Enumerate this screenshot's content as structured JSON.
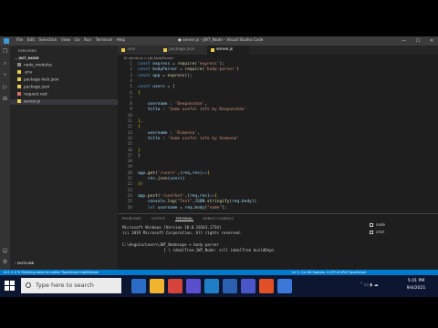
{
  "window": {
    "title": "● server.js - JWT_Node - Visual Studio Code",
    "menu": [
      "File",
      "Edit",
      "Selection",
      "View",
      "Go",
      "Run",
      "Terminal",
      "Help"
    ]
  },
  "explorer": {
    "title": "EXPLORER",
    "folder": "JWT_NODE",
    "files": [
      {
        "name": "node_modules",
        "color": "#8a8a8a"
      },
      {
        "name": ".env",
        "color": "#e8c94b"
      },
      {
        "name": "package-lock.json",
        "color": "#e8c94b"
      },
      {
        "name": "package.json",
        "color": "#e8c94b"
      },
      {
        "name": "request.rest",
        "color": "#d46a6a"
      },
      {
        "name": "server.js",
        "color": "#e8c94b"
      }
    ],
    "outline_label": "OUTLINE"
  },
  "tabs": [
    ".env",
    "package.json",
    "server.js"
  ],
  "breadcrumb": "JS server.js > [ø] bodyParser",
  "code": {
    "line_numbers": [
      "1",
      "2",
      "3",
      "4",
      "5",
      "6",
      "7",
      "8",
      "9",
      "10",
      "11",
      "12",
      "13",
      "14",
      "15",
      "16",
      "17",
      "18",
      "19",
      "20",
      "21",
      "22",
      "23",
      "24",
      "25",
      "26"
    ],
    "lines": [
      [
        {
          "c": "k",
          "t": "const "
        },
        {
          "c": "v",
          "t": "express"
        },
        {
          "c": "o",
          "t": " = "
        },
        {
          "c": "f",
          "t": "require"
        },
        {
          "c": "o",
          "t": "("
        },
        {
          "c": "s",
          "t": "'express'"
        },
        {
          "c": "o",
          "t": ");"
        }
      ],
      [
        {
          "c": "k",
          "t": "const "
        },
        {
          "c": "v",
          "t": "bodyParser"
        },
        {
          "c": "o",
          "t": " = "
        },
        {
          "c": "f",
          "t": "require"
        },
        {
          "c": "o",
          "t": "("
        },
        {
          "c": "s",
          "t": "'body-parser'"
        },
        {
          "c": "o",
          "t": ")"
        }
      ],
      [
        {
          "c": "k",
          "t": "const "
        },
        {
          "c": "v",
          "t": "app"
        },
        {
          "c": "o",
          "t": " = "
        },
        {
          "c": "f",
          "t": "express"
        },
        {
          "c": "o",
          "t": "();"
        }
      ],
      [],
      [
        {
          "c": "k",
          "t": "const "
        },
        {
          "c": "v",
          "t": "users"
        },
        {
          "c": "o",
          "t": " = ["
        }
      ],
      [
        {
          "c": "y",
          "t": "{"
        }
      ],
      [],
      [
        {
          "c": "o",
          "t": "    "
        },
        {
          "c": "v",
          "t": "username"
        },
        {
          "c": "o",
          "t": " : "
        },
        {
          "c": "s",
          "t": "'Deepanshan'"
        },
        {
          "c": "o",
          "t": ","
        }
      ],
      [
        {
          "c": "o",
          "t": "    "
        },
        {
          "c": "v",
          "t": "title"
        },
        {
          "c": "o",
          "t": " : "
        },
        {
          "c": "s",
          "t": "'Some useful info by Deepanshan'"
        }
      ],
      [],
      [
        {
          "c": "y",
          "t": "},"
        }
      ],
      [
        {
          "c": "y",
          "t": "{"
        }
      ],
      [
        {
          "c": "o",
          "t": "    "
        },
        {
          "c": "v",
          "t": "username"
        },
        {
          "c": "o",
          "t": " : "
        },
        {
          "c": "s",
          "t": "'Dimenza'"
        },
        {
          "c": "o",
          "t": ","
        }
      ],
      [
        {
          "c": "o",
          "t": "    "
        },
        {
          "c": "v",
          "t": "title"
        },
        {
          "c": "o",
          "t": " : "
        },
        {
          "c": "s",
          "t": "'Some useful info by Someone'"
        }
      ],
      [],
      [
        {
          "c": "y",
          "t": "}"
        }
      ],
      [
        {
          "c": "o",
          "t": "]"
        }
      ],
      [],
      [],
      [
        {
          "c": "v",
          "t": "app"
        },
        {
          "c": "o",
          "t": "."
        },
        {
          "c": "f",
          "t": "get"
        },
        {
          "c": "o",
          "t": "("
        },
        {
          "c": "s",
          "t": "'/users'"
        },
        {
          "c": "o",
          "t": ",("
        },
        {
          "c": "v",
          "t": "req"
        },
        {
          "c": "o",
          "t": ","
        },
        {
          "c": "v",
          "t": "res"
        },
        {
          "c": "o",
          "t": ")"
        },
        {
          "c": "k",
          "t": "=>"
        },
        {
          "c": "y",
          "t": "{"
        }
      ],
      [
        {
          "c": "o",
          "t": "    "
        },
        {
          "c": "v",
          "t": "res"
        },
        {
          "c": "o",
          "t": "."
        },
        {
          "c": "f",
          "t": "json"
        },
        {
          "c": "o",
          "t": "("
        },
        {
          "c": "v",
          "t": "users"
        },
        {
          "c": "o",
          "t": ")"
        }
      ],
      [
        {
          "c": "y",
          "t": "}"
        },
        {
          "c": "o",
          "t": ")"
        }
      ],
      [],
      [
        {
          "c": "v",
          "t": "app"
        },
        {
          "c": "o",
          "t": "."
        },
        {
          "c": "f",
          "t": "post"
        },
        {
          "c": "o",
          "t": "("
        },
        {
          "c": "s",
          "t": "'/userGet'"
        },
        {
          "c": "o",
          "t": ",("
        },
        {
          "c": "v",
          "t": "req"
        },
        {
          "c": "o",
          "t": ","
        },
        {
          "c": "v",
          "t": "res"
        },
        {
          "c": "o",
          "t": ")"
        },
        {
          "c": "k",
          "t": "=>"
        },
        {
          "c": "y",
          "t": "{"
        }
      ],
      [
        {
          "c": "o",
          "t": "    "
        },
        {
          "c": "v",
          "t": "console"
        },
        {
          "c": "o",
          "t": "."
        },
        {
          "c": "f",
          "t": "log"
        },
        {
          "c": "o",
          "t": "("
        },
        {
          "c": "s",
          "t": "\"Test\""
        },
        {
          "c": "o",
          "t": ","
        },
        {
          "c": "v",
          "t": "JSON"
        },
        {
          "c": "o",
          "t": "."
        },
        {
          "c": "f",
          "t": "stringify"
        },
        {
          "c": "o",
          "t": "("
        },
        {
          "c": "v",
          "t": "req"
        },
        {
          "c": "o",
          "t": "."
        },
        {
          "c": "v",
          "t": "body"
        },
        {
          "c": "o",
          "t": "))"
        }
      ],
      [
        {
          "c": "o",
          "t": "    "
        },
        {
          "c": "k",
          "t": "let "
        },
        {
          "c": "v",
          "t": "username"
        },
        {
          "c": "o",
          "t": " = "
        },
        {
          "c": "v",
          "t": "req"
        },
        {
          "c": "o",
          "t": "."
        },
        {
          "c": "v",
          "t": "body"
        },
        {
          "c": "o",
          "t": "["
        },
        {
          "c": "s",
          "t": "\"name\""
        },
        {
          "c": "o",
          "t": "];"
        }
      ]
    ]
  },
  "panel": {
    "tabs": [
      "PROBLEMS",
      "OUTPUT",
      "TERMINAL",
      "DEBUG CONSOLE"
    ],
    "active_tab": "TERMINAL",
    "terminal_lines": [
      "Microsoft Windows [Version 10.0.18363.1734]",
      "(c) 2019 Microsoft Corporation. All rights reserved.",
      "",
      "C:\\AngularLearn\\JWT_Nodecope > body-parser",
      "                  ] \\ idealTree:JWT_Node: sill idealTree buildDeps"
    ],
    "terminals": [
      "node",
      "cmd"
    ]
  },
  "statusbar": {
    "left": "⊗ 0 ⚠ 0   ↻ Fetching data for better TypeScript IntelliSense",
    "right": "Ln 2, Col 40   Spaces: 4   UTF-8   CRLF   JavaScript"
  },
  "taskbar": {
    "search_placeholder": "Type here to search",
    "time": "5:41 PM",
    "date": "9/4/2021",
    "apps": [
      "#2b6cc4",
      "#f2b32e",
      "#d4443b",
      "#5a4fcf",
      "#1f7fc6",
      "#2b5fb0",
      "#4a56c8",
      "#e34f26",
      "#3c78d8"
    ]
  }
}
